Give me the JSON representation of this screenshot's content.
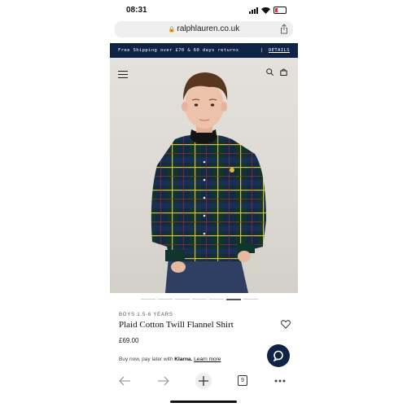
{
  "status": {
    "time": "08:31"
  },
  "browser": {
    "url": "ralphlauren.co.uk",
    "tab_count": "9"
  },
  "promo": {
    "text": "Free Shipping over £70 & 60 days returns",
    "separator": "|",
    "link": "DETAILS"
  },
  "product": {
    "eyebrow": "BOYS 1.5-6 YEARS",
    "title": "Plaid Cotton Twill Flannel Shirt",
    "price": "£69.00"
  },
  "klarna": {
    "prefix": "Buy now, pay later with",
    "brand": "Klarna.",
    "link": "Learn more"
  },
  "carousel": {
    "count": 7,
    "active_index": 5
  },
  "colors": {
    "navy": "#0f2346",
    "promo_bg": "#0f2346",
    "chat_bg": "#0f2346"
  },
  "icons": [
    "lock-icon",
    "share-icon",
    "menu-icon",
    "search-icon",
    "bag-icon",
    "heart-icon",
    "chat-icon",
    "back-icon",
    "forward-icon",
    "add-icon",
    "tabs-icon",
    "more-icon"
  ]
}
